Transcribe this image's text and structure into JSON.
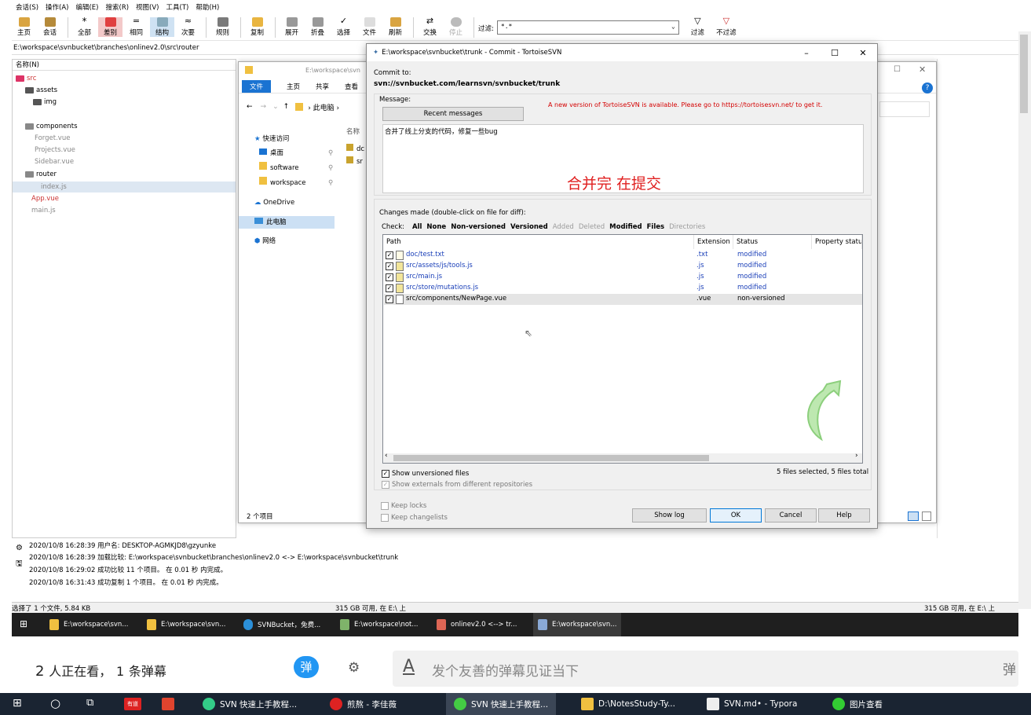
{
  "menu": [
    "会话(S)",
    "操作(A)",
    "编辑(E)",
    "搜索(R)",
    "视图(V)",
    "工具(T)",
    "帮助(H)"
  ],
  "toolbar": {
    "buttons": [
      "主页",
      "会话",
      "全部",
      "差别",
      "相同",
      "结构",
      "次要",
      "规则",
      "复制",
      "展开",
      "折叠",
      "选择",
      "文件",
      "刷新",
      "交换",
      "停止"
    ],
    "filter_label": "过滤:",
    "filter_value": "*.*",
    "filter_btn": "过滤",
    "nofilter_btn": "不过滤"
  },
  "path": "E:\\workspace\\svnbucket\\branches\\onlinev2.0\\src\\router",
  "tree": {
    "header": "名称(N)",
    "nodes": [
      "src",
      "assets",
      "img",
      "components",
      "Forget.vue",
      "Projects.vue",
      "Sidebar.vue",
      "router",
      "index.js",
      "App.vue",
      "main.js"
    ]
  },
  "explorer": {
    "title_path": "E:\\workspace\\svn",
    "ribbon": [
      "文件",
      "主页",
      "共享",
      "查看"
    ],
    "breadcrumb": "此电脑",
    "col_name": "名称",
    "files": [
      "dc",
      "sr"
    ],
    "sidebar": [
      "快速访问",
      "桌面",
      "software",
      "workspace",
      "OneDrive",
      "此电脑",
      "网络"
    ],
    "status": "2 个项目"
  },
  "commit": {
    "title": "E:\\workspace\\svnbucket\\trunk - Commit - TortoiseSVN",
    "commit_to_label": "Commit to:",
    "commit_url": "svn://svnbucket.com/learnsvn/svnbucket/trunk",
    "message_label": "Message:",
    "recent_btn": "Recent messages",
    "update_note": "A new version of TortoiseSVN is available. Please go to https://tortoisesvn.net/ to get it.",
    "message_text": "合并了线上分支的代码，修复一些bug",
    "overlay_note": "合并完 在提交",
    "changes_label": "Changes made (double-click on file for diff):",
    "check_label": "Check:",
    "check_items": [
      "All",
      "None",
      "Non-versioned",
      "Versioned",
      "Added",
      "Deleted",
      "Modified",
      "Files",
      "Directories"
    ],
    "columns": [
      "Path",
      "Extension",
      "Status",
      "Property statu"
    ],
    "files": [
      {
        "path": "doc/test.txt",
        "ext": ".txt",
        "status": "modified"
      },
      {
        "path": "src/assets/js/tools.js",
        "ext": ".js",
        "status": "modified"
      },
      {
        "path": "src/main.js",
        "ext": ".js",
        "status": "modified"
      },
      {
        "path": "src/store/mutations.js",
        "ext": ".js",
        "status": "modified"
      },
      {
        "path": "src/components/NewPage.vue",
        "ext": ".vue",
        "status": "non-versioned"
      }
    ],
    "show_unversioned": "Show unversioned files",
    "show_externals": "Show externals from different repositories",
    "selection_summary": "5 files selected, 5 files total",
    "keep_locks": "Keep locks",
    "keep_changelists": "Keep changelists",
    "buttons": {
      "show_log": "Show log",
      "ok": "OK",
      "cancel": "Cancel",
      "help": "Help"
    }
  },
  "log": [
    "2020/10/8 16:28:39  用户名:  DESKTOP-AGMKJD8\\gzyunke",
    "2020/10/8 16:28:39  加载比较:  E:\\workspace\\svnbucket\\branches\\onlinev2.0 <-> E:\\workspace\\svnbucket\\trunk",
    "2020/10/8 16:29:02  成功比较 11 个项目。 在 0.01 秒 内完成。",
    "2020/10/8 16:31:43  成功复制 1 个项目。 在 0.01 秒 内完成。"
  ],
  "statusbar": {
    "left": "选择了 1 个文件, 5.84 KB",
    "mid": "315 GB 可用, 在 E:\\ 上",
    "right": "315 GB 可用, 在 E:\\ 上"
  },
  "inner_taskbar": [
    "E:\\workspace\\svn...",
    "E:\\workspace\\svn...",
    "SVNBucket，免费...",
    "E:\\workspace\\not...",
    "onlinev2.0 <--> tr...",
    "E:\\workspace\\svn..."
  ],
  "danmu": {
    "count": "2",
    "viewers_text": "人正在看，",
    "dm_count": "1",
    "dm_text": "条弹幕",
    "btn": "弹",
    "placeholder": "发个友善的弹幕见证当下",
    "send": "弹"
  },
  "outer_taskbar": [
    "有道",
    "SVN 快速上手教程...",
    "煎熬 - 李佳薇",
    "SVN 快速上手教程...",
    "D:\\NotesStudy-Ty...",
    "SVN.md• - Typora",
    "图片查看"
  ],
  "colors": {
    "accent": "#1a73d2",
    "red": "#e02020",
    "link": "#1a3fb8"
  }
}
